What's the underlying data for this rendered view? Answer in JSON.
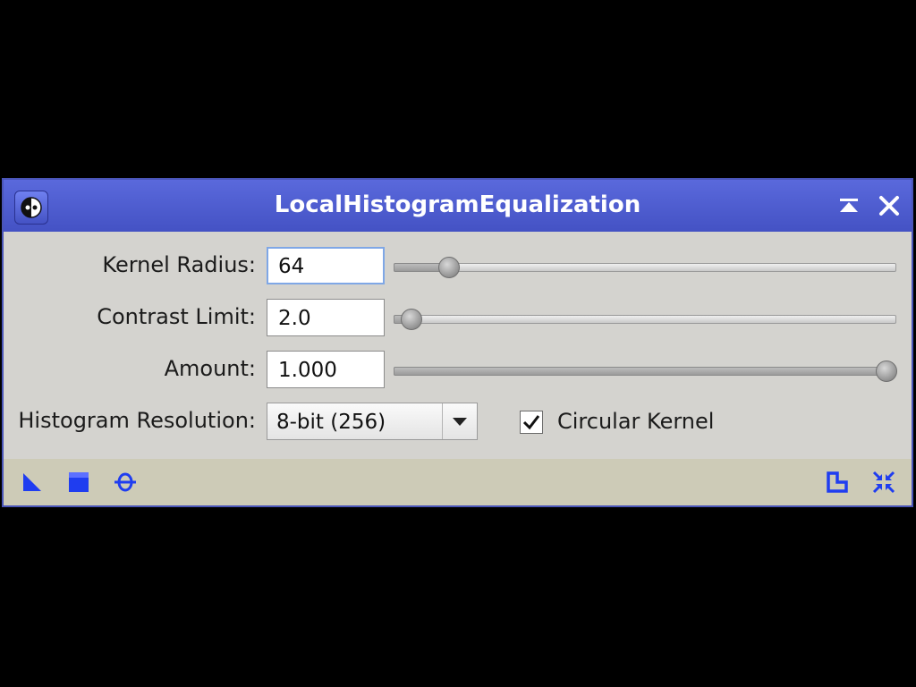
{
  "window": {
    "title": "LocalHistogramEqualization",
    "icons": {
      "app": "app-process-icon",
      "shade": "shade-icon",
      "close": "close-icon"
    }
  },
  "params": {
    "kernel_radius": {
      "label": "Kernel Radius:",
      "value": "64",
      "slider_fraction": 0.11
    },
    "contrast_limit": {
      "label": "Contrast Limit:",
      "value": "2.0",
      "slider_fraction": 0.035
    },
    "amount": {
      "label": "Amount:",
      "value": "1.000",
      "slider_fraction": 0.98
    }
  },
  "histogram_resolution": {
    "label": "Histogram Resolution:",
    "selected": "8-bit (256)"
  },
  "circular_kernel": {
    "label": "Circular Kernel",
    "checked": true
  },
  "bottom_bar": {
    "left_icons": [
      "new-instance-icon",
      "apply-global-icon",
      "real-time-preview-icon"
    ],
    "right_icons": [
      "reset-icon",
      "collapse-icon"
    ]
  },
  "colors": {
    "titlebar": "#4a59cc",
    "accent": "#1f3df0",
    "panel": "#d4d3cf",
    "bottombar": "#cdcbb7"
  }
}
